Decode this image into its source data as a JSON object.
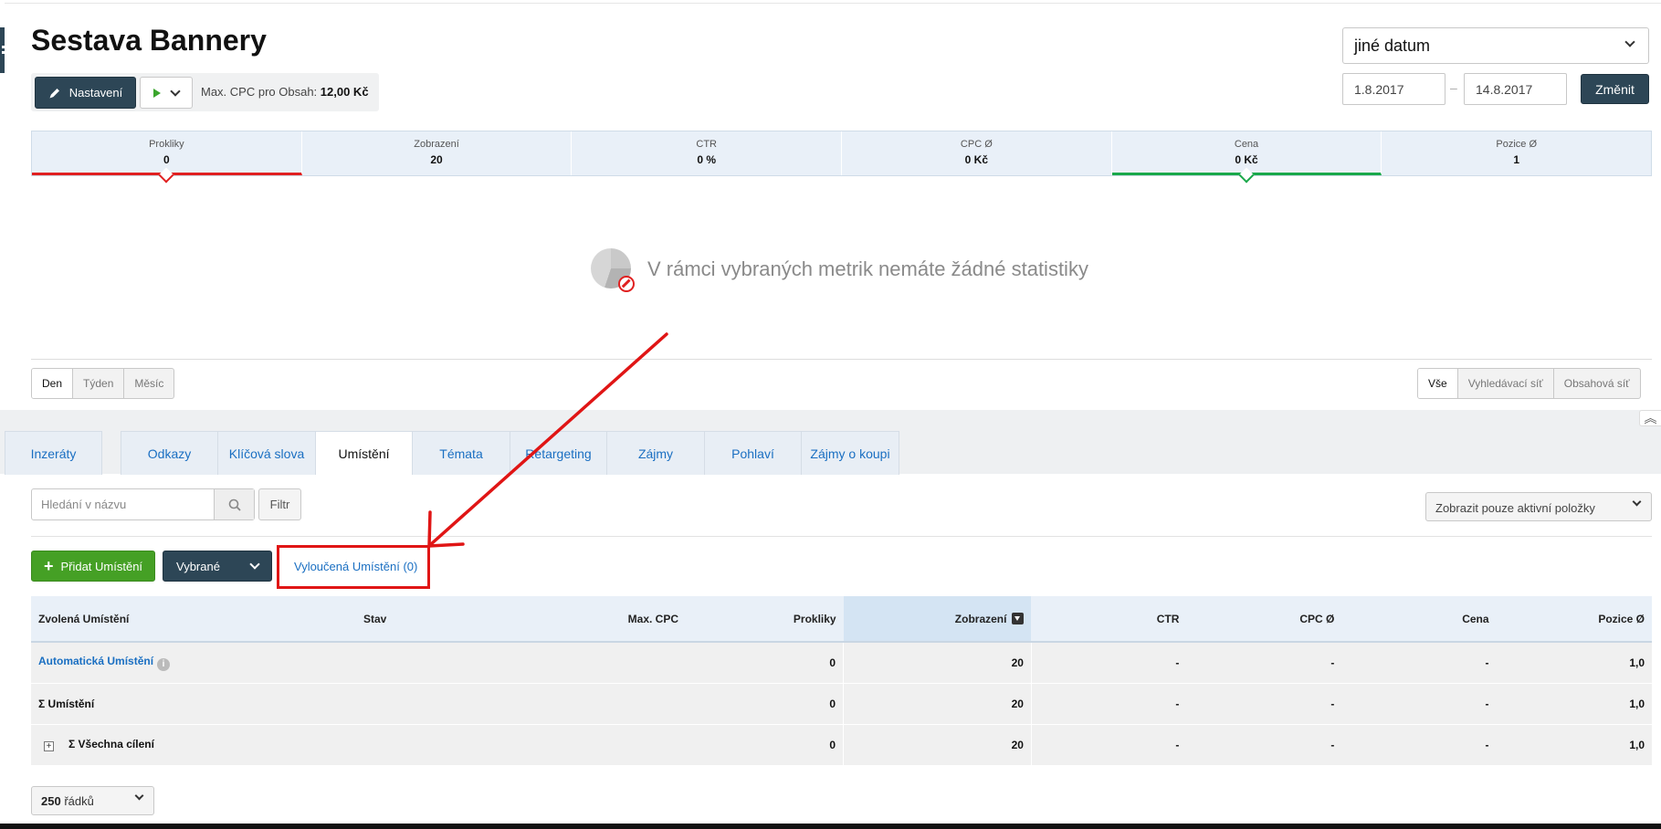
{
  "header": {
    "title": "Sestava Bannery",
    "settings_label": "Nastavení",
    "max_cpc_label": "Max. CPC pro Obsah:",
    "max_cpc_value": "12,00 Kč"
  },
  "date_range": {
    "preset": "jiné datum",
    "from": "1.8.2017",
    "separator": "–",
    "to": "14.8.2017",
    "change_label": "Změnit"
  },
  "metrics": [
    {
      "label": "Prokliky",
      "value": "0"
    },
    {
      "label": "Zobrazení",
      "value": "20"
    },
    {
      "label": "CTR",
      "value": "0 %"
    },
    {
      "label": "CPC Ø",
      "value": "0 Kč"
    },
    {
      "label": "Cena",
      "value": "0 Kč"
    },
    {
      "label": "Pozice Ø",
      "value": "1"
    }
  ],
  "empty_message": "V rámci vybraných metrik nemáte žádné statistiky",
  "period_buttons": [
    "Den",
    "Týden",
    "Měsíc"
  ],
  "network_buttons": [
    "Vše",
    "Vyhledávací síť",
    "Obsahová síť"
  ],
  "tabs": [
    "Inzeráty",
    "Odkazy",
    "Klíčová slova",
    "Umístění",
    "Témata",
    "Retargeting",
    "Zájmy",
    "Pohlaví",
    "Zájmy o koupi"
  ],
  "filters": {
    "search_placeholder": "Hledání v názvu",
    "filter_label": "Filtr",
    "active_only": "Zobrazit pouze aktivní položky"
  },
  "actions": {
    "add_label": "Přidat Umístění",
    "selected_label": "Vybrané",
    "excluded_link": "Vyloučená Umístění (0)"
  },
  "table": {
    "columns": [
      "Zvolená Umístění",
      "Stav",
      "Max. CPC",
      "Prokliky",
      "Zobrazení",
      "CTR",
      "CPC Ø",
      "Cena",
      "Pozice Ø"
    ],
    "rows": [
      {
        "name": "Automatická Umístění",
        "stav": "",
        "max_cpc": "",
        "prokliky": "0",
        "zobrazeni": "20",
        "ctr": "-",
        "cpc": "-",
        "cena": "-",
        "pozice": "1,0"
      },
      {
        "name": "Σ Umístění",
        "stav": "",
        "max_cpc": "",
        "prokliky": "0",
        "zobrazeni": "20",
        "ctr": "-",
        "cpc": "-",
        "cena": "-",
        "pozice": "1,0"
      },
      {
        "name": "Σ Všechna cílení",
        "stav": "",
        "max_cpc": "",
        "prokliky": "0",
        "zobrazeni": "20",
        "ctr": "-",
        "cpc": "-",
        "cena": "-",
        "pozice": "1,0"
      }
    ]
  },
  "pagination": {
    "rows_count": "250",
    "rows_label": "řádků"
  },
  "colors": {
    "accent_dark": "#2d4656",
    "link": "#1a6fc2",
    "add_green": "#45a025",
    "annotation_red": "#e01515"
  }
}
